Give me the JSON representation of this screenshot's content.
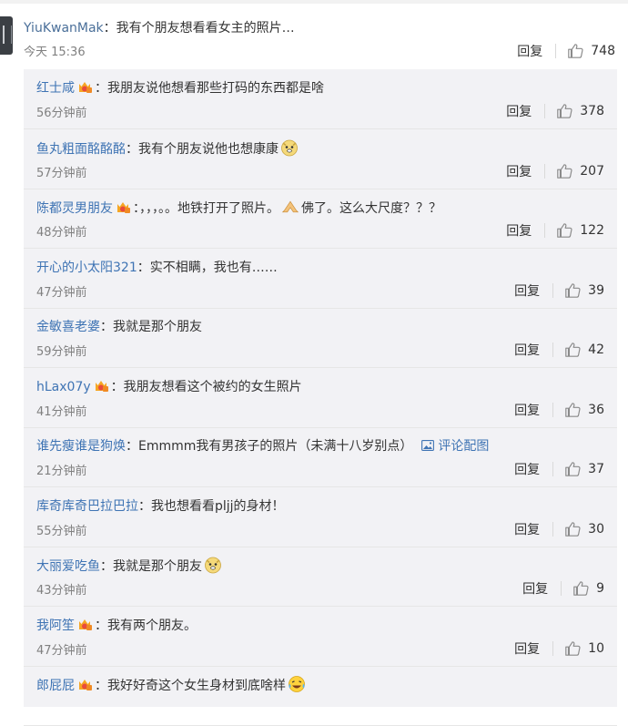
{
  "main_comment": {
    "author": "YiuKwanMak",
    "separator": "：",
    "text": "我有个朋友想看看女主的照片…",
    "time": "今天 15:36",
    "reply_label": "回复",
    "likes": "748"
  },
  "replies": [
    {
      "author": "红士咸",
      "badge": true,
      "sep": "：",
      "text": "我朋友说他想看那些打码的东西都是啥",
      "emoji": "",
      "time": "56分钟前",
      "reply_label": "回复",
      "likes": "378"
    },
    {
      "author": "鱼丸粗面酩酩酩",
      "badge": false,
      "sep": "：",
      "text": "我有个朋友说他也想康康",
      "emoji": "doge",
      "time": "57分钟前",
      "reply_label": "回复",
      "likes": "207"
    },
    {
      "author": "陈都灵男朋友",
      "badge": true,
      "sep": "：",
      "text": "，，，。。地铁打开了照片。",
      "text2": "佛了。这么大尺度？？？",
      "emoji": "pray",
      "time": "48分钟前",
      "reply_label": "回复",
      "likes": "122"
    },
    {
      "author": "开心的小太阳321",
      "badge": false,
      "sep": "：",
      "text": "实不相瞒，我也有……",
      "emoji": "",
      "time": "47分钟前",
      "reply_label": "回复",
      "likes": "39"
    },
    {
      "author": "金敏喜老婆",
      "badge": false,
      "sep": "：",
      "text": "我就是那个朋友",
      "emoji": "",
      "time": "59分钟前",
      "reply_label": "回复",
      "likes": "42"
    },
    {
      "author": "hLax07y",
      "badge": true,
      "sep": "：",
      "text": "我朋友想看这个被约的女生照片",
      "emoji": "",
      "time": "41分钟前",
      "reply_label": "回复",
      "likes": "36"
    },
    {
      "author": "谁先瘦谁是狗焕",
      "badge": false,
      "sep": "：",
      "text": "Emmmm我有男孩子的照片（未满十八岁别点）",
      "review_pic": "评论配图",
      "emoji": "",
      "time": "21分钟前",
      "reply_label": "回复",
      "likes": "37"
    },
    {
      "author": "库奇库奇巴拉巴拉",
      "badge": false,
      "sep": "：",
      "text": "我也想看看pljj的身材！",
      "emoji": "",
      "time": "55分钟前",
      "reply_label": "回复",
      "likes": "30"
    },
    {
      "author": "大丽爱吃鱼",
      "badge": false,
      "sep": "：",
      "text": "我就是那个朋友",
      "emoji": "doge",
      "time": "43分钟前",
      "reply_label": "回复",
      "likes": "9"
    },
    {
      "author": "我阿笙",
      "badge": true,
      "sep": "：",
      "text": "我有两个朋友。",
      "emoji": "",
      "time": "47分钟前",
      "reply_label": "回复",
      "likes": "10"
    },
    {
      "author": "郎屁屁",
      "badge": true,
      "sep": "：",
      "text": "我好好奇这个女生身材到底啥样",
      "emoji": "laugh-cry",
      "time": "",
      "reply_label": "",
      "likes": ""
    }
  ],
  "colors": {
    "name_link": "#3f74b4",
    "reply_bg": "#f2f2f5",
    "meta_gray": "#808080"
  }
}
